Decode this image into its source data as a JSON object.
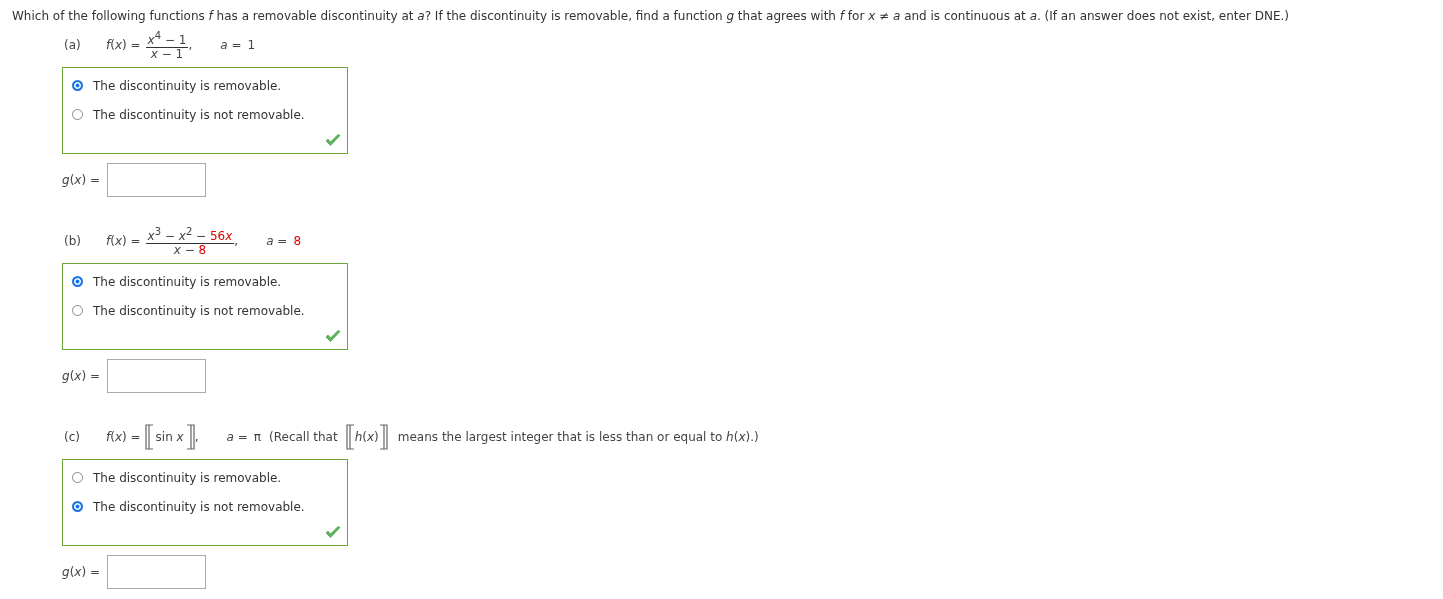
{
  "instruction": "Which of the following functions *f* has a removable discontinuity at *a*? If the discontinuity is removable, find a function *g* that agrees with *f* for *x* ≠ *a* and is continuous at *a*. (If an answer does not exist, enter DNE.)",
  "parts": [
    {
      "label": "(a)",
      "kind": "fraction",
      "lhs": "*f*(*x*) =",
      "numerator": [
        {
          "text": "*x*$^{4}$ − 1",
          "highlight": false
        }
      ],
      "denominator": [
        {
          "text": "*x* − 1",
          "highlight": false
        }
      ],
      "separator": ",",
      "a_label": "*a* =",
      "a_value": {
        "text": "1",
        "highlight": false
      },
      "options": [
        {
          "text": "The discontinuity is removable.",
          "selected": true
        },
        {
          "text": "The discontinuity is not removable.",
          "selected": false
        }
      ],
      "correct": true,
      "answer_label": "*g*(*x*) ="
    },
    {
      "label": "(b)",
      "kind": "fraction",
      "lhs": "*f*(*x*) =",
      "numerator": [
        {
          "text": "*x*$^{3}$ − *x*$^{2}$ − ",
          "highlight": false
        },
        {
          "text": "56",
          "highlight": true
        },
        {
          "text": "*x*",
          "highlight": true
        }
      ],
      "denominator": [
        {
          "text": "*x* − ",
          "highlight": false
        },
        {
          "text": "8",
          "highlight": true
        }
      ],
      "separator": ",",
      "a_label": "*a* =",
      "a_value": {
        "text": "8",
        "highlight": true
      },
      "options": [
        {
          "text": "The discontinuity is removable.",
          "selected": true
        },
        {
          "text": "The discontinuity is not removable.",
          "selected": false
        }
      ],
      "correct": true,
      "answer_label": "*g*(*x*) ="
    },
    {
      "label": "(c)",
      "kind": "floor",
      "lhs": "*f*(*x*) =",
      "floor_content": "sin *x*",
      "separator": ",",
      "a_label": "*a* =",
      "a_value": {
        "text": "π",
        "highlight": false
      },
      "note_before": "(Recall that",
      "note_floor": "*h*(*x*)",
      "note_after": "means the largest integer that is less than or equal to *h*(*x*).)",
      "options": [
        {
          "text": "The discontinuity is removable.",
          "selected": false
        },
        {
          "text": "The discontinuity is not removable.",
          "selected": true
        }
      ],
      "correct": true,
      "answer_label": "*g*(*x*) ="
    }
  ]
}
